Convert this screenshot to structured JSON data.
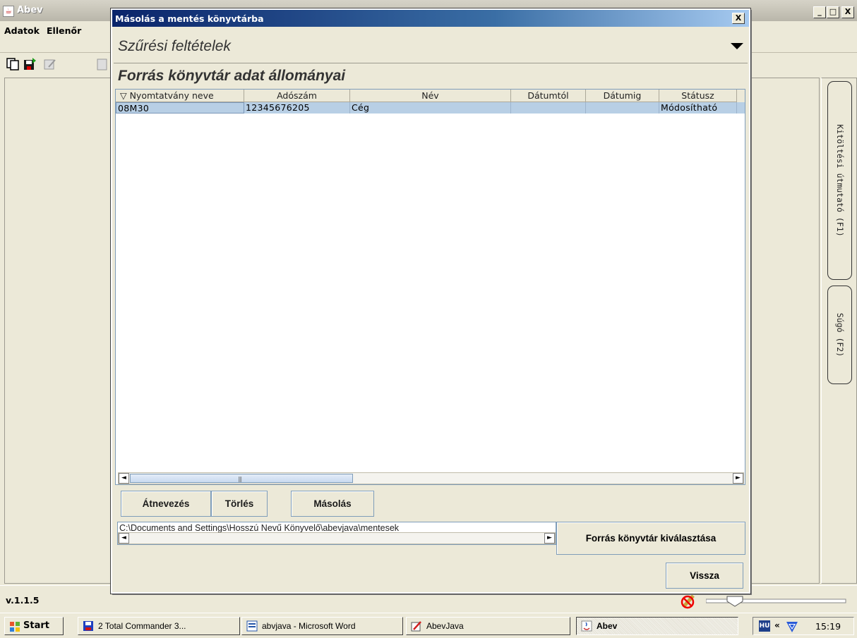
{
  "main_window": {
    "title": "Abev",
    "controls": {
      "minimize": "_",
      "maximize": "□",
      "close": "X"
    },
    "menu": [
      "Adatok",
      "Ellenőr"
    ],
    "toolbar_icons": [
      "copy-forms-icon",
      "save-icon",
      "edit-icon",
      "other-icon"
    ],
    "version": "v.1.1.5",
    "right_tabs": {
      "guide": "Kitöltési útmutató (F1)",
      "help": "Súgó (F2)"
    }
  },
  "dialog": {
    "title": "Másolás a mentés könyvtárba",
    "close_label": "X",
    "filter_title": "Szűrési feltételek",
    "source_title": "Forrás könyvtár adat állományai",
    "table": {
      "columns": [
        "▽ Nyomtatvány neve",
        "Adószám",
        "Név",
        "Dátumtól",
        "Dátumig",
        "Státusz"
      ],
      "rows": [
        {
          "form_name": "08M30",
          "tax_id": "12345676205",
          "name": "Cég",
          "date_from": "",
          "date_to": "",
          "status": "Módosítható"
        }
      ]
    },
    "buttons": {
      "rename": "Átnevezés",
      "delete": "Törlés",
      "copy": "Másolás",
      "choose_source": "Forrás könyvtár kiválasztása",
      "back": "Vissza"
    },
    "path": "C:\\Documents and Settings\\Hosszú Nevű Könyvelő\\abevjava\\mentesek",
    "scroll": {
      "left": "◄",
      "right": "►",
      "grip": "|||"
    }
  },
  "taskbar": {
    "start": "Start",
    "tasks": [
      {
        "label": "2 Total Commander 3...",
        "icon": "total-commander-icon"
      },
      {
        "label": "abvjava - Microsoft Word",
        "icon": "word-icon"
      },
      {
        "label": "AbevJava",
        "icon": "abevjava-icon"
      },
      {
        "label": "Abev",
        "icon": "java-icon",
        "active": true
      }
    ],
    "tray": {
      "language": "HU",
      "expand": "«",
      "clock": "15:19"
    }
  },
  "colors": {
    "dialog_titlebar": "#0a246a",
    "selected_row": "#b8cfe5",
    "window_bg": "#ece9d8"
  }
}
